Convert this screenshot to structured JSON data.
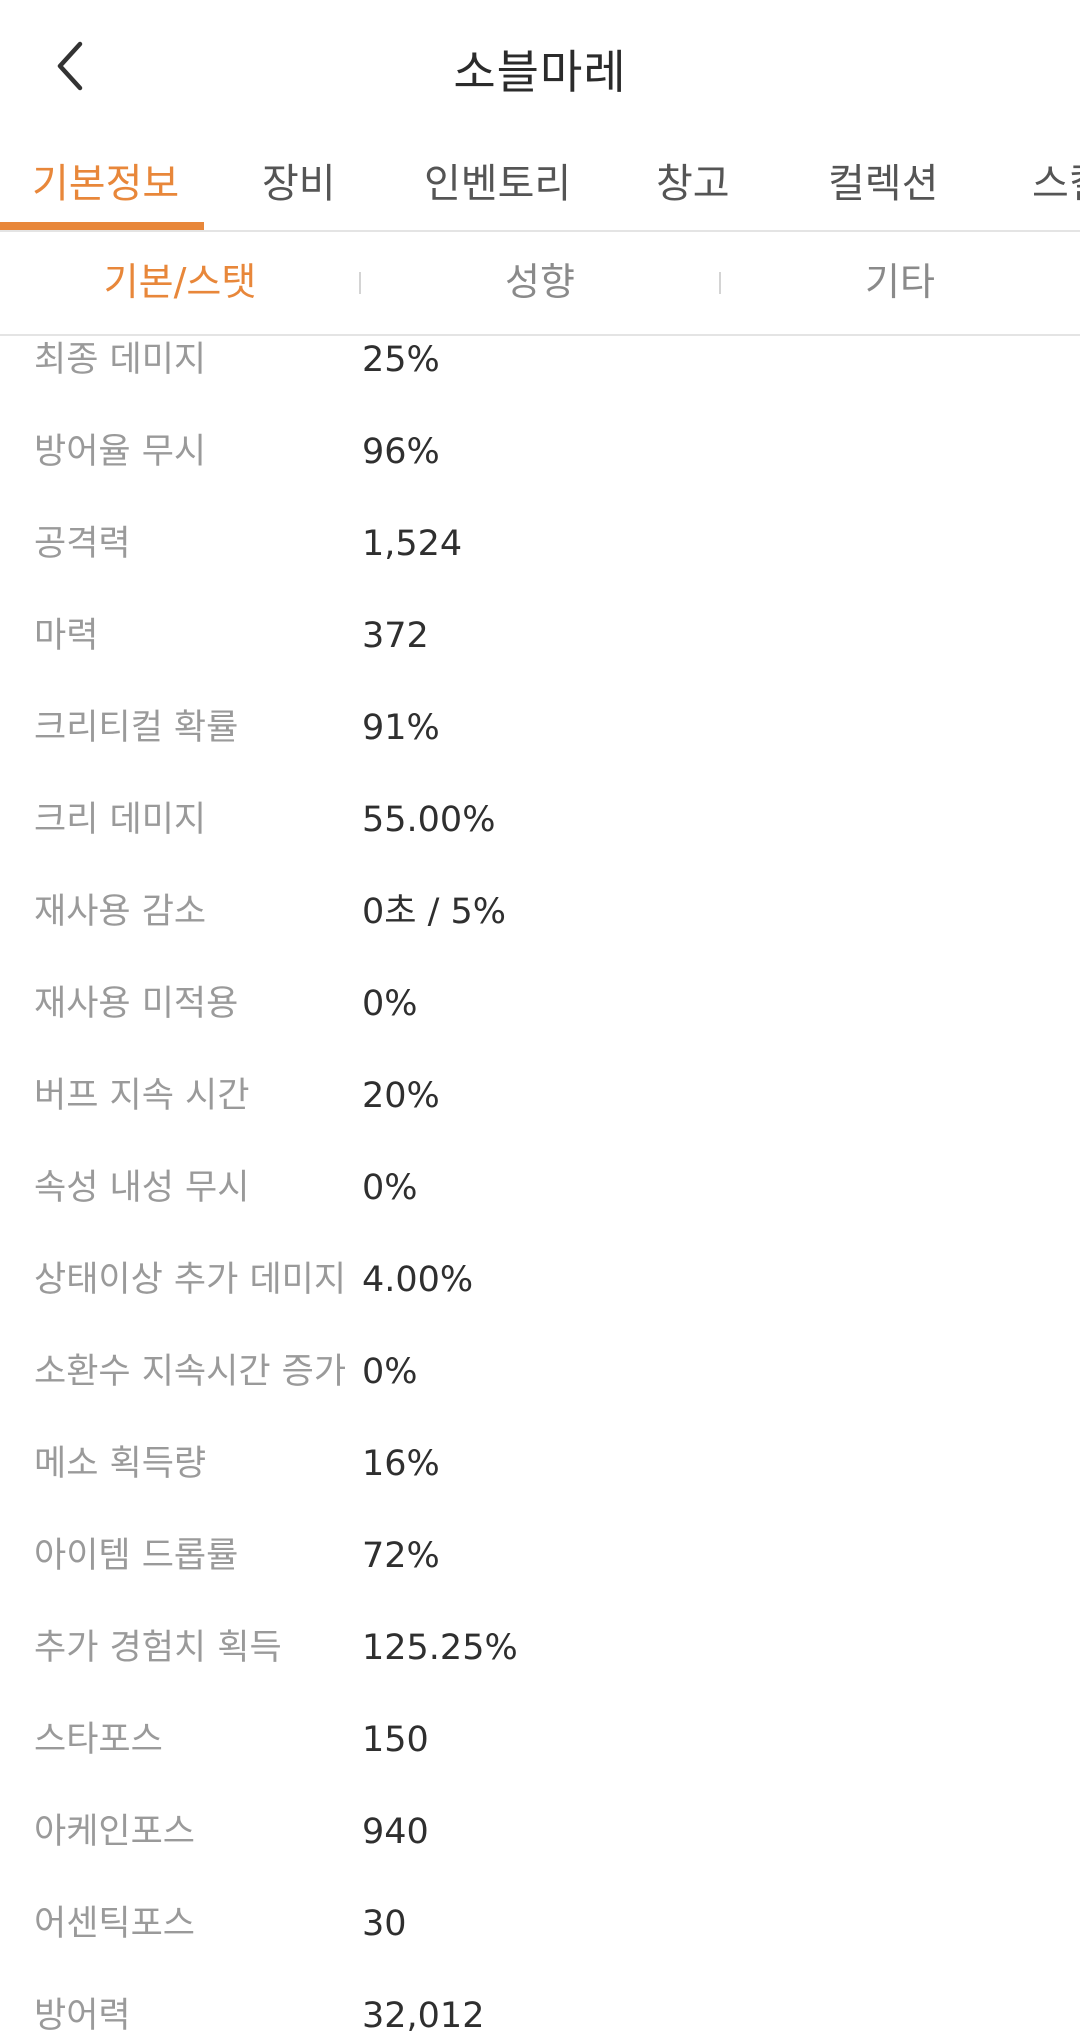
{
  "header": {
    "title": "소블마레",
    "back_icon": "chevron-left-icon"
  },
  "main_tabs": [
    {
      "label": "기본정보",
      "active": true
    },
    {
      "label": "장비",
      "active": false
    },
    {
      "label": "인벤토리",
      "active": false
    },
    {
      "label": "창고",
      "active": false
    },
    {
      "label": "컬렉션",
      "active": false
    },
    {
      "label": "스킬",
      "active": false
    }
  ],
  "sub_tabs": [
    {
      "label": "기본/스탯",
      "active": true
    },
    {
      "label": "성향",
      "active": false
    },
    {
      "label": "기타",
      "active": false
    }
  ],
  "stats": [
    {
      "label": "최종 데미지",
      "value": "25%"
    },
    {
      "label": "방어율 무시",
      "value": "96%"
    },
    {
      "label": "공격력",
      "value": "1,524"
    },
    {
      "label": "마력",
      "value": "372"
    },
    {
      "label": "크리티컬 확률",
      "value": "91%"
    },
    {
      "label": "크리 데미지",
      "value": "55.00%"
    },
    {
      "label": "재사용 감소",
      "value": "0초 / 5%"
    },
    {
      "label": "재사용 미적용",
      "value": "0%"
    },
    {
      "label": "버프 지속 시간",
      "value": "20%"
    },
    {
      "label": "속성 내성 무시",
      "value": "0%"
    },
    {
      "label": "상태이상 추가 데미지",
      "value": "4.00%"
    },
    {
      "label": "소환수 지속시간 증가",
      "value": "0%"
    },
    {
      "label": "메소 획득량",
      "value": "16%"
    },
    {
      "label": "아이템 드롭률",
      "value": "72%"
    },
    {
      "label": "추가 경험치 획득",
      "value": "125.25%"
    },
    {
      "label": "스타포스",
      "value": "150"
    },
    {
      "label": "아케인포스",
      "value": "940"
    },
    {
      "label": "어센틱포스",
      "value": "30"
    },
    {
      "label": "방어력",
      "value": "32,012"
    }
  ],
  "colors": {
    "accent": "#e8873a",
    "label": "#9a9a9a",
    "value": "#2f2f2f",
    "divider": "#e4e4e4"
  }
}
